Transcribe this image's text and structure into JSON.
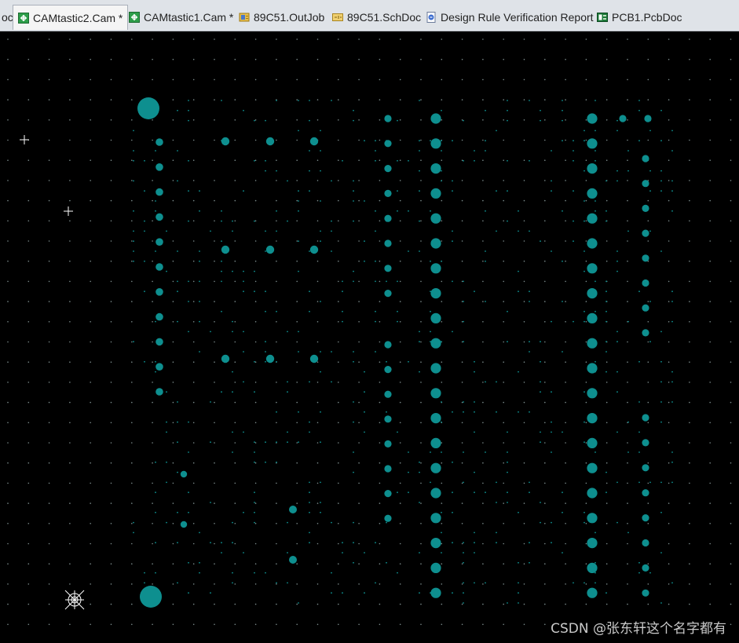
{
  "tabs": [
    {
      "label": "oc",
      "icon": "none",
      "active": false
    },
    {
      "label": "CAMtastic2.Cam *",
      "icon": "cam-file-icon",
      "active": true
    },
    {
      "label": "CAMtastic1.Cam *",
      "icon": "cam-file-icon",
      "active": false
    },
    {
      "label": "89C51.OutJob",
      "icon": "outjob-file-icon",
      "active": false
    },
    {
      "label": "89C51.SchDoc",
      "icon": "schematic-file-icon",
      "active": false
    },
    {
      "label": "Design Rule Verification Report",
      "icon": "report-file-icon",
      "active": false
    },
    {
      "label": "PCB1.PcbDoc",
      "icon": "pcb-file-icon",
      "active": false
    }
  ],
  "colors": {
    "background": "#000000",
    "pad": "#0e8f8f",
    "grid": "#7a8a8a",
    "tabbar": "#dfe3e8"
  },
  "watermark": "CSDN @张东轩这个名字都有"
}
